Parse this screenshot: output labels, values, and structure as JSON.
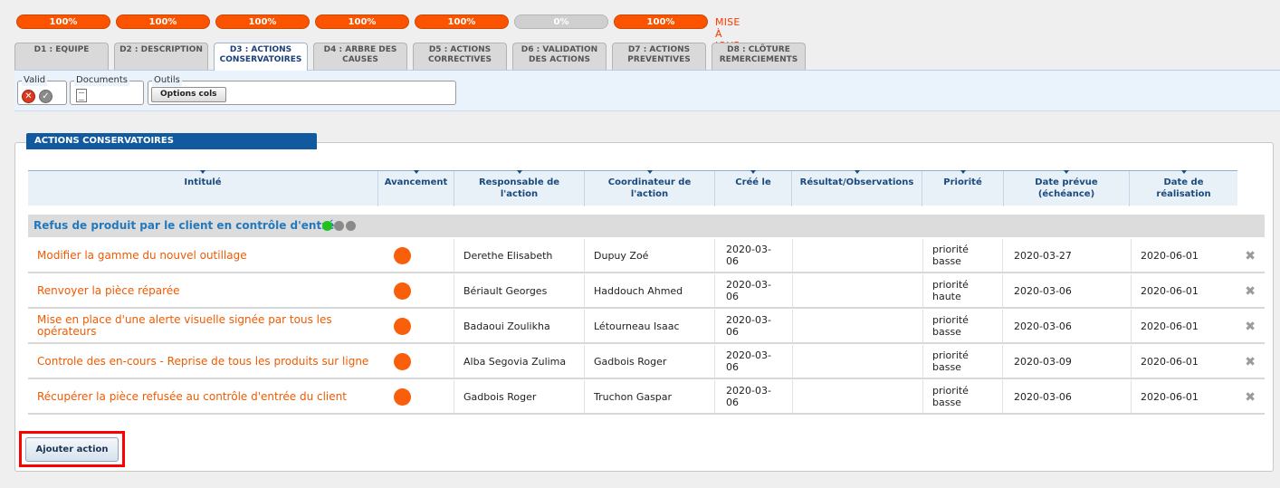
{
  "progress": {
    "pills": [
      "100%",
      "100%",
      "100%",
      "100%",
      "100%",
      "0%",
      "100%"
    ],
    "update_label": "MISE À JOUR"
  },
  "tabs": [
    {
      "line1": "D1 : EQUIPE",
      "line2": ""
    },
    {
      "line1": "D2 : DESCRIPTION",
      "line2": ""
    },
    {
      "line1": "D3 : ACTIONS",
      "line2": "CONSERVATOIRES"
    },
    {
      "line1": "D4 : ARBRE DES",
      "line2": "CAUSES"
    },
    {
      "line1": "D5 : ACTIONS",
      "line2": "CORRECTIVES"
    },
    {
      "line1": "D6 : VALIDATION",
      "line2": "DES ACTIONS"
    },
    {
      "line1": "D7 : ACTIONS",
      "line2": "PREVENTIVES"
    },
    {
      "line1": "D8 : CLÔTURE",
      "line2": "REMERCIEMENTS"
    }
  ],
  "toolbar": {
    "valid_legend": "Valid",
    "documents_legend": "Documents",
    "outils_legend": "Outils",
    "options_cols_label": "Options cols"
  },
  "section": {
    "title": "ACTIONS CONSERVATOIRES"
  },
  "table": {
    "headers": [
      {
        "l1": "Intitulé",
        "l2": ""
      },
      {
        "l1": "Avancement",
        "l2": ""
      },
      {
        "l1": "Responsable de",
        "l2": "l'action"
      },
      {
        "l1": "Coordinateur de",
        "l2": "l'action"
      },
      {
        "l1": "Créé le",
        "l2": ""
      },
      {
        "l1": "Résultat/Observations",
        "l2": ""
      },
      {
        "l1": "Priorité",
        "l2": ""
      },
      {
        "l1": "Date prévue",
        "l2": "(échéance)"
      },
      {
        "l1": "Date de",
        "l2": "réalisation"
      }
    ],
    "group_label": "Refus de produit par le client en contrôle d'entrée",
    "group_dot_colors": [
      "#22c21e",
      "#8a8a8a",
      "#8a8a8a"
    ],
    "rows": [
      {
        "title": "Modifier la gamme du nouvel outillage",
        "title2": "",
        "resp": "Derethe Elisabeth",
        "coord": "Dupuy Zoé",
        "created1": "2020-03-",
        "created2": "06",
        "result": "",
        "prio1": "priorité",
        "prio2": "basse",
        "due": "2020-03-27",
        "done": "2020-06-01"
      },
      {
        "title": "Renvoyer la pièce réparée",
        "title2": "",
        "resp": "Bériault Georges",
        "coord": "Haddouch Ahmed",
        "created1": "2020-03-",
        "created2": "06",
        "result": "",
        "prio1": "priorité",
        "prio2": "haute",
        "due": "2020-03-06",
        "done": "2020-06-01"
      },
      {
        "title": "Mise en place d'une alerte visuelle signée par tous les",
        "title2": "opérateurs",
        "resp": "Badaoui Zoulikha",
        "coord": "Létourneau Isaac",
        "created1": "2020-03-",
        "created2": "06",
        "result": "",
        "prio1": "priorité",
        "prio2": "basse",
        "due": "2020-03-06",
        "done": "2020-06-01"
      },
      {
        "title": "Controle des en-cours - Reprise de tous les produits sur ligne",
        "title2": "",
        "resp": "Alba Segovia Zulima",
        "coord": "Gadbois Roger",
        "created1": "2020-03-",
        "created2": "06",
        "result": "",
        "prio1": "priorité",
        "prio2": "basse",
        "due": "2020-03-09",
        "done": "2020-06-01"
      },
      {
        "title": "Récupérer la pièce refusée au contrôle d'entrée du client",
        "title2": "",
        "resp": "Gadbois Roger",
        "coord": "Truchon Gaspar",
        "created1": "2020-03-",
        "created2": "06",
        "result": "",
        "prio1": "priorité",
        "prio2": "basse",
        "due": "2020-03-06",
        "done": "2020-06-01"
      }
    ],
    "delete_glyph": "✖",
    "status_color": "#f95f0a"
  },
  "add_button_label": "Ajouter action"
}
